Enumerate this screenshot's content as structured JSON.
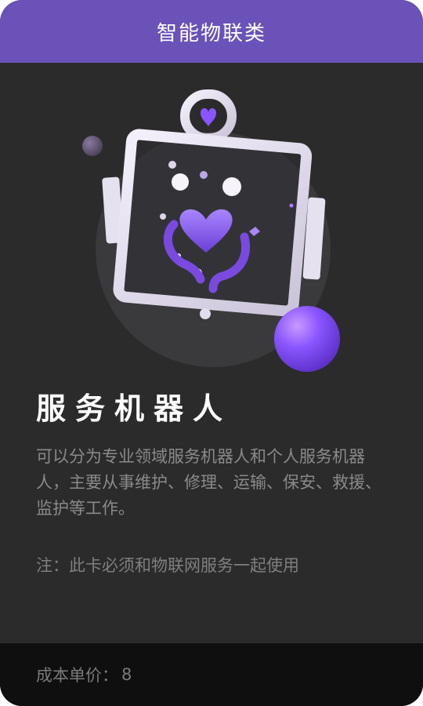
{
  "card": {
    "category": "智能物联类",
    "title": "服务机器人",
    "description": "可以分为专业领域服务机器人和个人服务机器人，主要从事维护、修理、运输、保安、救援、监护等工作。",
    "note": "注：此卡必须和物联网服务一起使用",
    "price_label": "成本单价：",
    "price_value": "8"
  },
  "illustration": {
    "icon": "service-robot-heart-hands-icon",
    "accent_color": "#8a55ff",
    "header_color": "#6a52b8"
  }
}
